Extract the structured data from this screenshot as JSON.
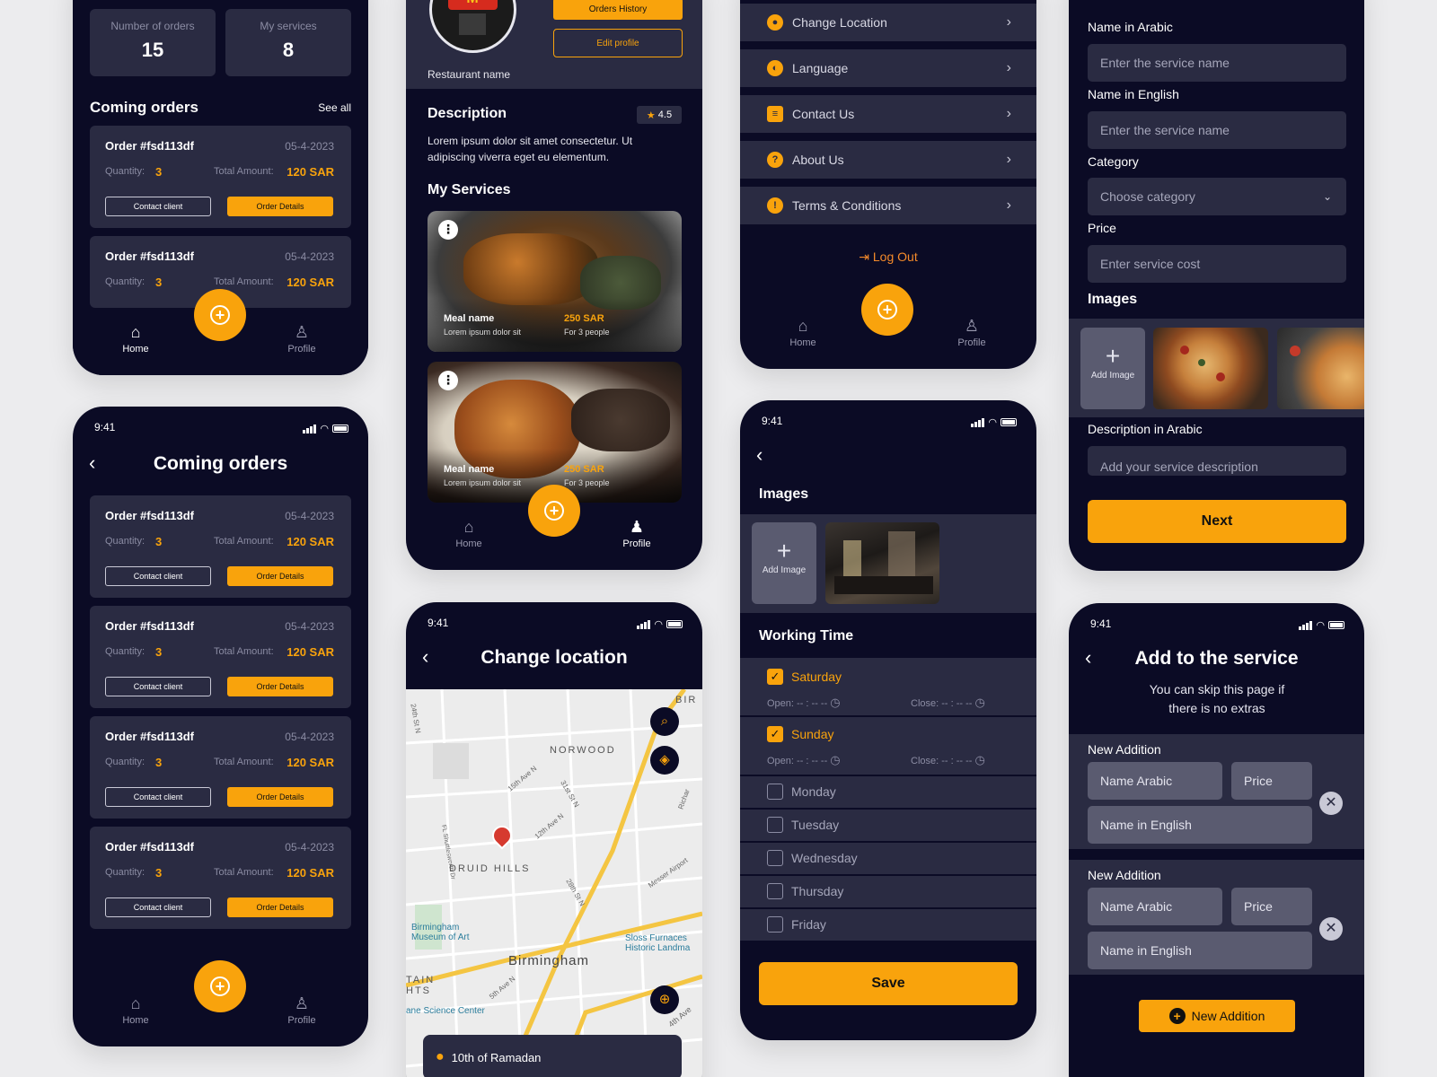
{
  "dash": {
    "stat1_label": "Number of orders",
    "stat1_value": "15",
    "stat2_label": "My services",
    "stat2_value": "8",
    "section_title": "Coming orders",
    "see_all": "See all",
    "order_id": "Order #fsd113df",
    "order_date": "05-4-2023",
    "qty_label": "Quantity:",
    "qty_value": "3",
    "total_label": "Total Amount:",
    "total_value": "120 SAR",
    "contact_label": "Contact client",
    "details_label": "Order Details",
    "nav_home": "Home",
    "nav_profile": "Profile"
  },
  "orders_screen": {
    "time": "9:41",
    "title": "Coming orders",
    "orders": [
      {
        "id": "Order #fsd113df",
        "date": "05-4-2023",
        "qty": "3",
        "total": "120 SAR"
      },
      {
        "id": "Order #fsd113df",
        "date": "05-4-2023",
        "qty": "3",
        "total": "120 SAR"
      },
      {
        "id": "Order #fsd113df",
        "date": "05-4-2023",
        "qty": "3",
        "total": "120 SAR"
      },
      {
        "id": "Order #fsd113df",
        "date": "05-4-2023",
        "qty": "3",
        "total": "120 SAR"
      }
    ]
  },
  "profile": {
    "orders_history": "Orders History",
    "edit_profile": "Edit profile",
    "restaurant_name": "Restaurant name",
    "desc_title": "Description",
    "rating": "4.5",
    "desc_text": "Lorem ipsum dolor sit amet consectetur. Ut adipiscing viverra eget eu elementum.",
    "services_title": "My Services",
    "services": [
      {
        "name": "Meal name",
        "sub": "Lorem ipsum dolor sit",
        "price": "250 SAR",
        "people": "For 3 people"
      },
      {
        "name": "Meal name",
        "sub": "Lorem ipsum dolor sit",
        "price": "250 SAR",
        "people": "For 3 people"
      }
    ]
  },
  "settings": {
    "items": [
      "Change Location",
      "Language",
      "Contact Us",
      "About Us",
      "Terms & Conditions"
    ],
    "logout": "Log Out"
  },
  "location": {
    "time": "9:41",
    "title": "Change location",
    "map_labels": [
      "NORWOOD",
      "DRUID HILLS",
      "Birmingham",
      "Birmingham Museum of Art",
      "Sloss Furnaces Historic Landma",
      "ane Science Center",
      "BIR",
      "TAIN HTS",
      "Messer Airport",
      "12th Ave N",
      "15th Ave N",
      "31st St N",
      "28th St N",
      "24th St N",
      "5th Ave N",
      "4th Ave",
      "Richar",
      "FL Shuttlesworth Dr"
    ],
    "selected": "10th of Ramadan"
  },
  "working": {
    "time": "9:41",
    "images_title": "Images",
    "add_image": "Add Image",
    "section_title": "Working Time",
    "open_label": "Open:",
    "close_label": "Close:",
    "time_placeholder": "-- : -- --",
    "days": [
      {
        "name": "Saturday",
        "checked": true
      },
      {
        "name": "Sunday",
        "checked": true
      },
      {
        "name": "Monday",
        "checked": false
      },
      {
        "name": "Tuesday",
        "checked": false
      },
      {
        "name": "Wednesday",
        "checked": false
      },
      {
        "name": "Thursday",
        "checked": false
      },
      {
        "name": "Friday",
        "checked": false
      }
    ],
    "save": "Save"
  },
  "service_form": {
    "name_ar_label": "Name in Arabic",
    "name_ar_ph": "Enter the service name",
    "name_en_label": "Name in English",
    "name_en_ph": "Enter the service name",
    "category_label": "Category",
    "category_ph": "Choose category",
    "price_label": "Price",
    "price_ph": "Enter service cost",
    "images_label": "Images",
    "add_image": "Add Image",
    "desc_ar_label": "Description in Arabic",
    "desc_ar_ph": "Add your service description",
    "next": "Next"
  },
  "add_service": {
    "time": "9:41",
    "title": "Add to the service",
    "subtitle": "You can skip this page if there is no extras",
    "additions": [
      {
        "label": "New Addition",
        "name_ar": "Name Arabic",
        "price": "Price",
        "name_en": "Name in English"
      },
      {
        "label": "New Addition",
        "name_ar": "Name Arabic",
        "price": "Price",
        "name_en": "Name in English"
      }
    ],
    "new_addition_button": "New Addition"
  },
  "colors": {
    "bg": "#0b0b25",
    "card": "#2a2b42",
    "accent": "#f9a30c"
  }
}
